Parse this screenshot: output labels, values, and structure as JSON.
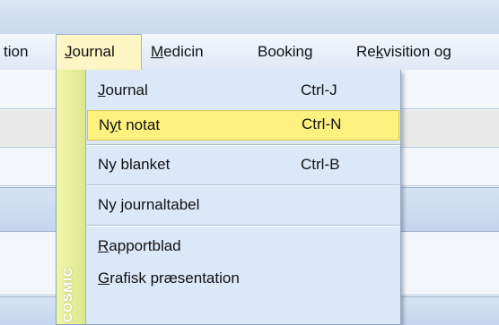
{
  "menubar": {
    "items": [
      {
        "prefix": "",
        "accel": "",
        "rest": "tion"
      },
      {
        "prefix": "",
        "accel": "J",
        "rest": "ournal"
      },
      {
        "prefix": "",
        "accel": "M",
        "rest": "edicin"
      },
      {
        "prefix": "Boo",
        "accel": "k",
        "rest": "ing"
      },
      {
        "prefix": "Re",
        "accel": "k",
        "rest": "visition og"
      }
    ]
  },
  "dropdown": {
    "side_label": "COSMIC",
    "items": [
      {
        "prefix": "",
        "accel": "J",
        "rest": "ournal",
        "shortcut": "Ctrl-J"
      },
      {
        "prefix": "N",
        "accel": "y",
        "rest": "t notat",
        "shortcut": "Ctrl-N"
      },
      {
        "prefix": "Ny blanket",
        "accel": "",
        "rest": "",
        "shortcut": "Ctrl-B"
      },
      {
        "prefix": "Ny journaltabel",
        "accel": "",
        "rest": "",
        "shortcut": ""
      },
      {
        "prefix": "",
        "accel": "R",
        "rest": "apportblad",
        "shortcut": ""
      },
      {
        "prefix": "",
        "accel": "G",
        "rest": "rafisk præsentation",
        "shortcut": ""
      }
    ]
  }
}
